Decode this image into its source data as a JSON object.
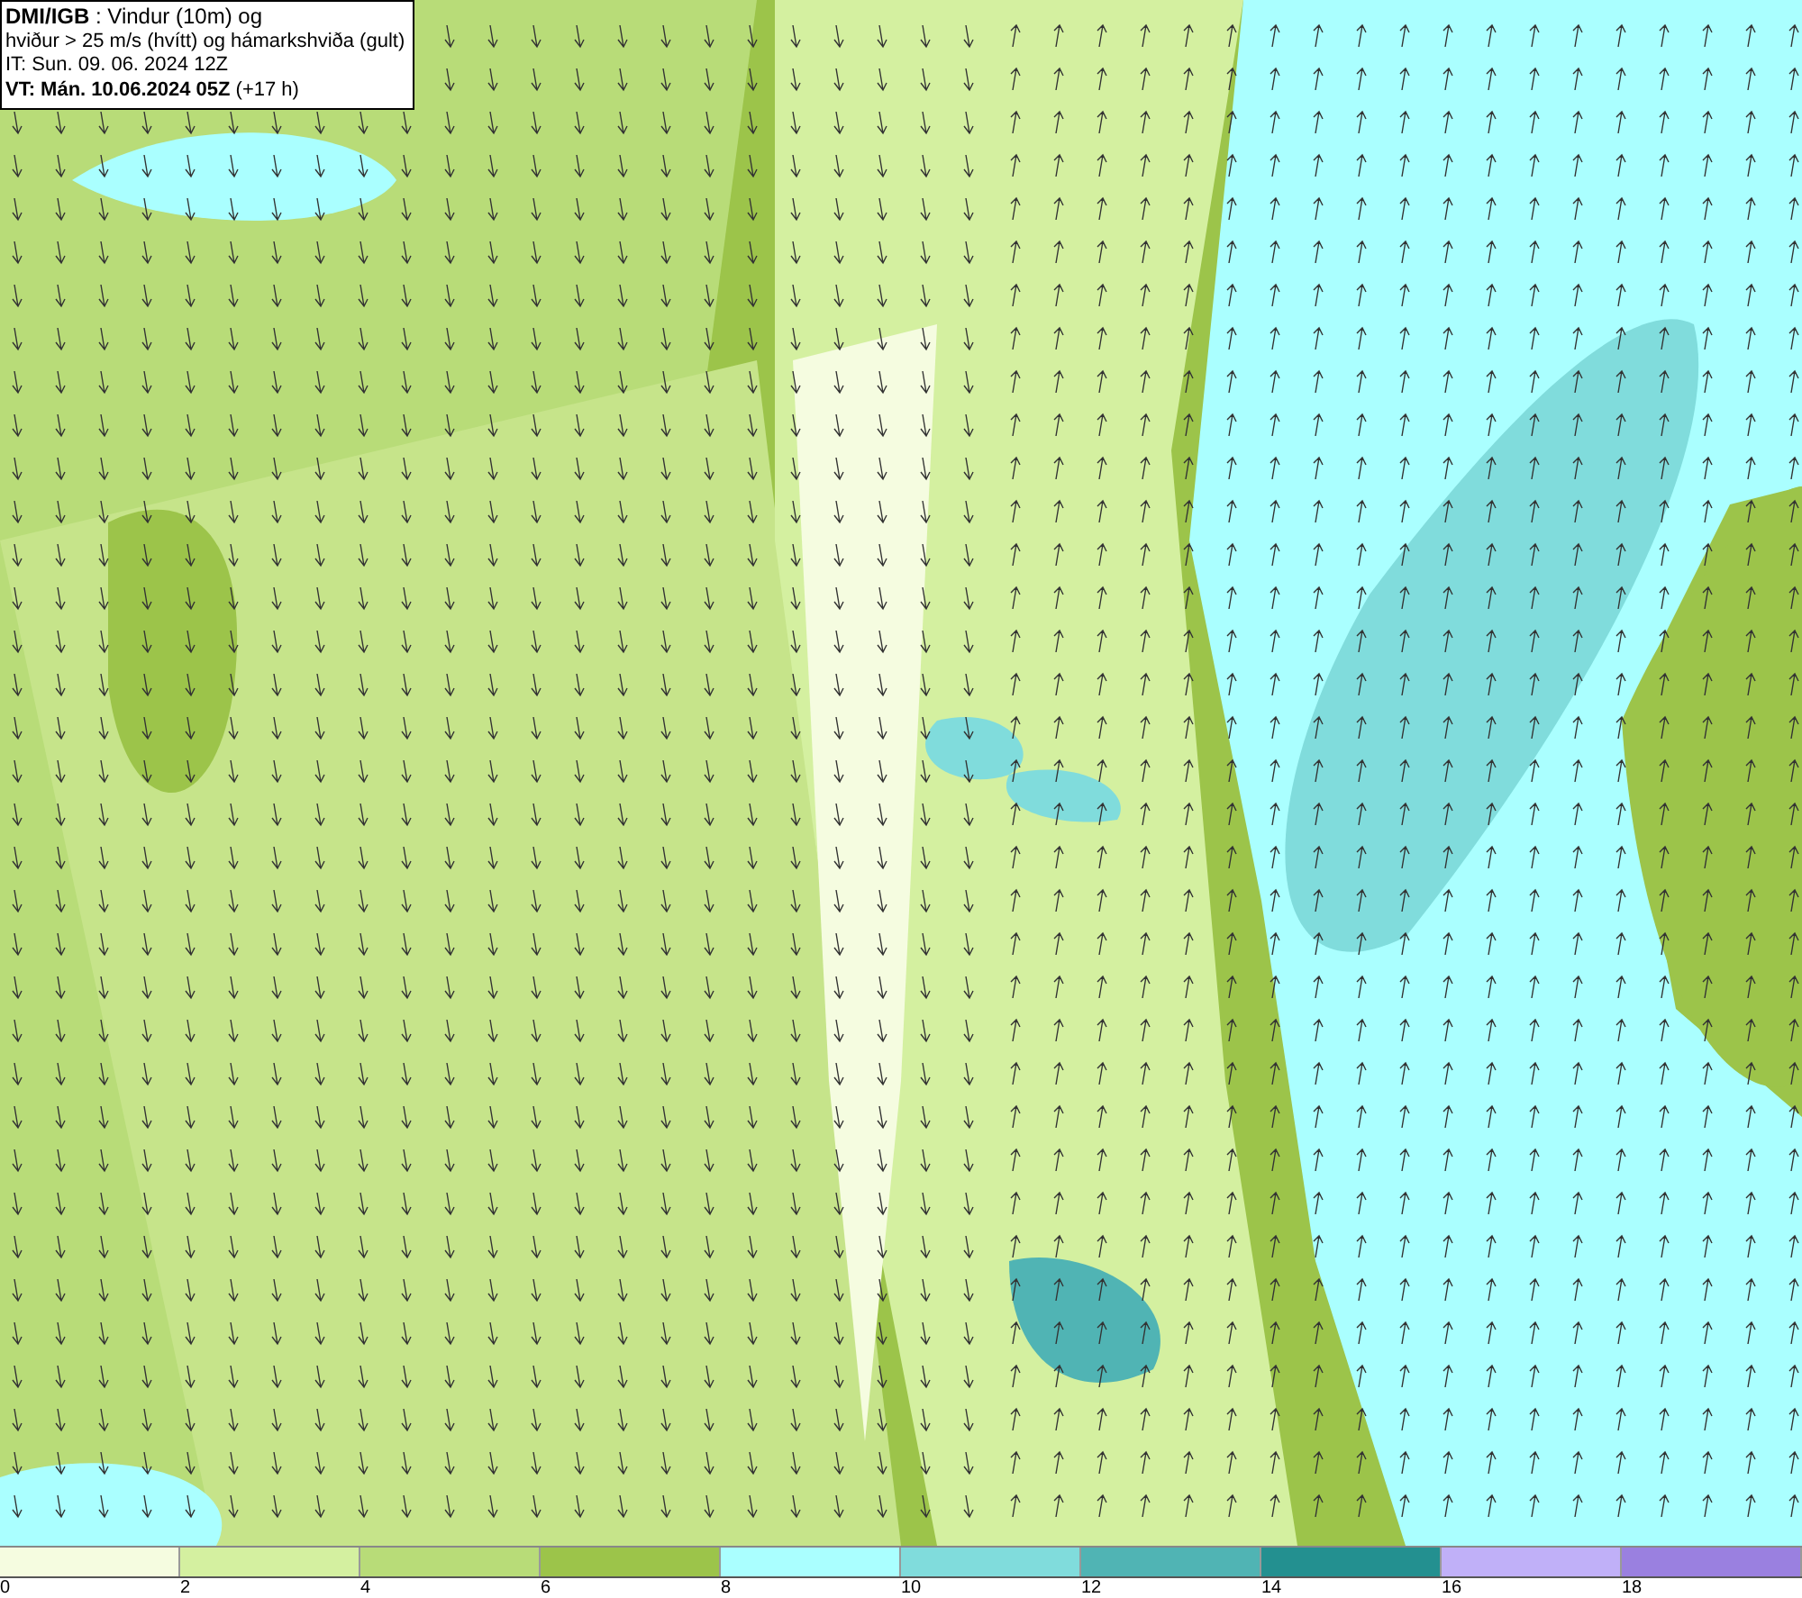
{
  "info_box": {
    "lines": [
      "**DMI/IGB** : Vindur (10m) og",
      "hviður > 25 m/s (hvítt) og hámarkshviða (gult)",
      "IT: Sun. 09. 06. 2024 12Z",
      "**VT: Mán. 10.06.2024 05Z** (+17 h)"
    ]
  },
  "legend": {
    "bins": [
      {
        "label": "0",
        "color": "#f5fce0"
      },
      {
        "label": "2",
        "color": "#d4f0a0"
      },
      {
        "label": "4",
        "color": "#b8dc78"
      },
      {
        "label": "6",
        "color": "#9cc44a"
      },
      {
        "label": "8",
        "color": "#aaffff"
      },
      {
        "label": "10",
        "color": "#80dcdc"
      },
      {
        "label": "12",
        "color": "#50b4b4"
      },
      {
        "label": "14",
        "color": "#239090"
      },
      {
        "label": "16",
        "color": "#c0b0f8"
      },
      {
        "label": "18",
        "color": "#9a80e0"
      }
    ]
  }
}
